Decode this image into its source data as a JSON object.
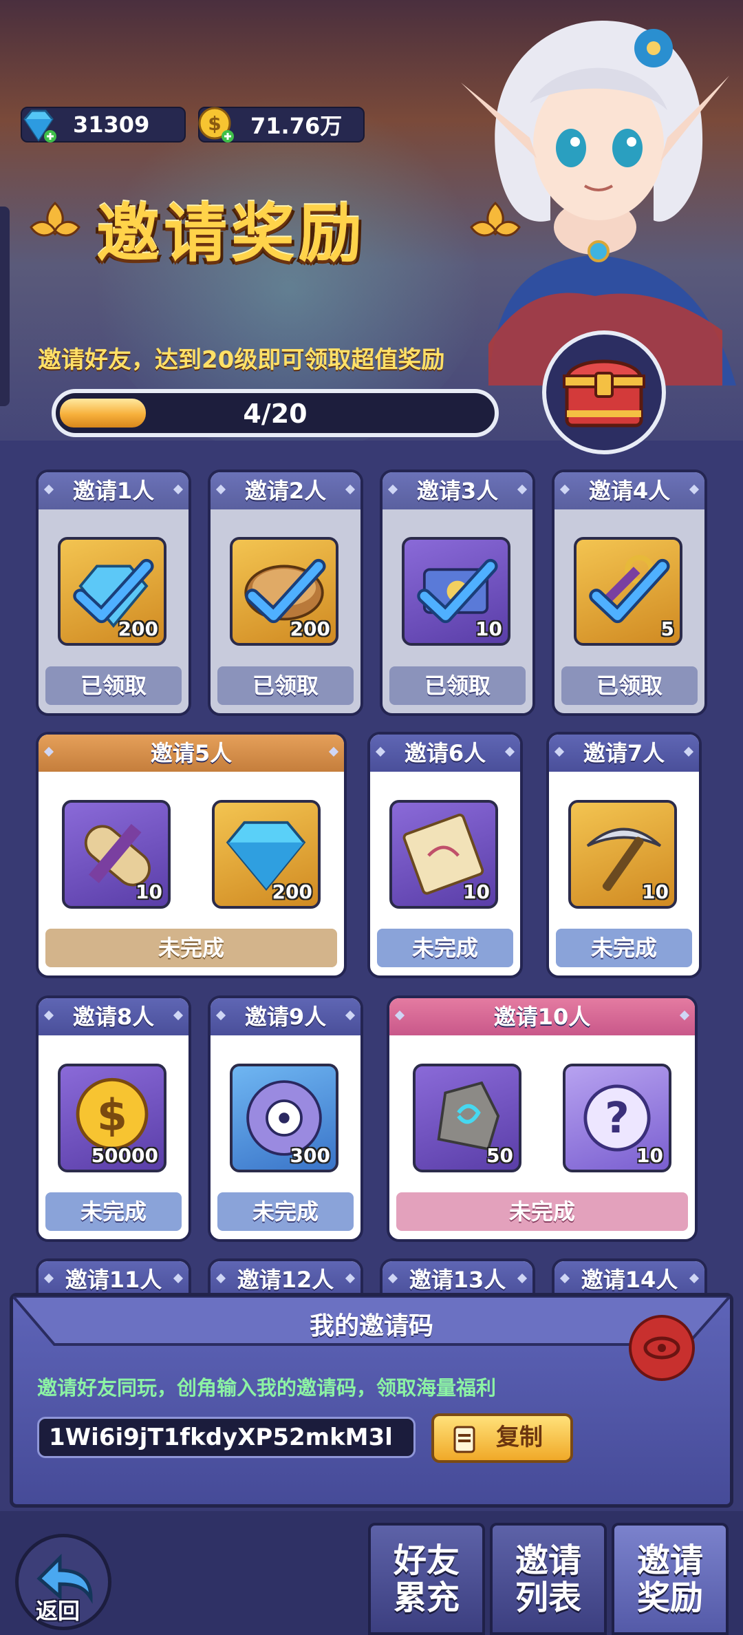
{
  "currency": {
    "gems": "31309",
    "gold": "71.76万"
  },
  "header": {
    "title": "邀请奖励",
    "subtitle": "邀请好友，达到20级即可领取超值奖励"
  },
  "progress": {
    "text": "4/20",
    "fraction": 0.2
  },
  "rewards": [
    {
      "label": "邀请1人",
      "status": "已领取",
      "items": [
        {
          "icon": "gem-icon",
          "qty": "200"
        }
      ]
    },
    {
      "label": "邀请2人",
      "status": "已领取",
      "items": [
        {
          "icon": "bread-icon",
          "qty": "200"
        }
      ]
    },
    {
      "label": "邀请3人",
      "status": "已领取",
      "items": [
        {
          "icon": "scroll-icon",
          "qty": "10"
        }
      ]
    },
    {
      "label": "邀请4人",
      "status": "已领取",
      "items": [
        {
          "icon": "key-icon",
          "qty": "5"
        }
      ]
    },
    {
      "label": "邀请5人",
      "status": "未完成",
      "items": [
        {
          "icon": "scroll-roll-icon",
          "qty": "10"
        },
        {
          "icon": "diamond-icon",
          "qty": "200"
        }
      ]
    },
    {
      "label": "邀请6人",
      "status": "未完成",
      "items": [
        {
          "icon": "map-scroll-icon",
          "qty": "10"
        }
      ]
    },
    {
      "label": "邀请7人",
      "status": "未完成",
      "items": [
        {
          "icon": "pickaxe-icon",
          "qty": "10"
        }
      ]
    },
    {
      "label": "邀请8人",
      "status": "未完成",
      "items": [
        {
          "icon": "gold-coin-icon",
          "qty": "50000"
        }
      ]
    },
    {
      "label": "邀请9人",
      "status": "未完成",
      "items": [
        {
          "icon": "saw-blade-icon",
          "qty": "300"
        }
      ]
    },
    {
      "label": "邀请10人",
      "status": "未完成",
      "items": [
        {
          "icon": "rune-stone-icon",
          "qty": "50"
        },
        {
          "icon": "mystery-box-icon",
          "qty": "10"
        }
      ]
    },
    {
      "label": "邀请11人"
    },
    {
      "label": "邀请12人"
    },
    {
      "label": "邀请13人"
    },
    {
      "label": "邀请14人"
    }
  ],
  "invite_code": {
    "title": "我的邀请码",
    "description": "邀请好友同玩，创角输入我的邀请码，领取海量福利",
    "code": "1Wi6i9jT1fkdyXP52mkM3l",
    "copy_label": "复制"
  },
  "nav": {
    "back_label": "返回",
    "tabs": [
      "好友\n累充",
      "邀请\n列表",
      "邀请\n奖励"
    ]
  },
  "colors": {
    "accent": "#ffd34a",
    "panel": "#464b98",
    "success_text": "#8cf2a4"
  }
}
